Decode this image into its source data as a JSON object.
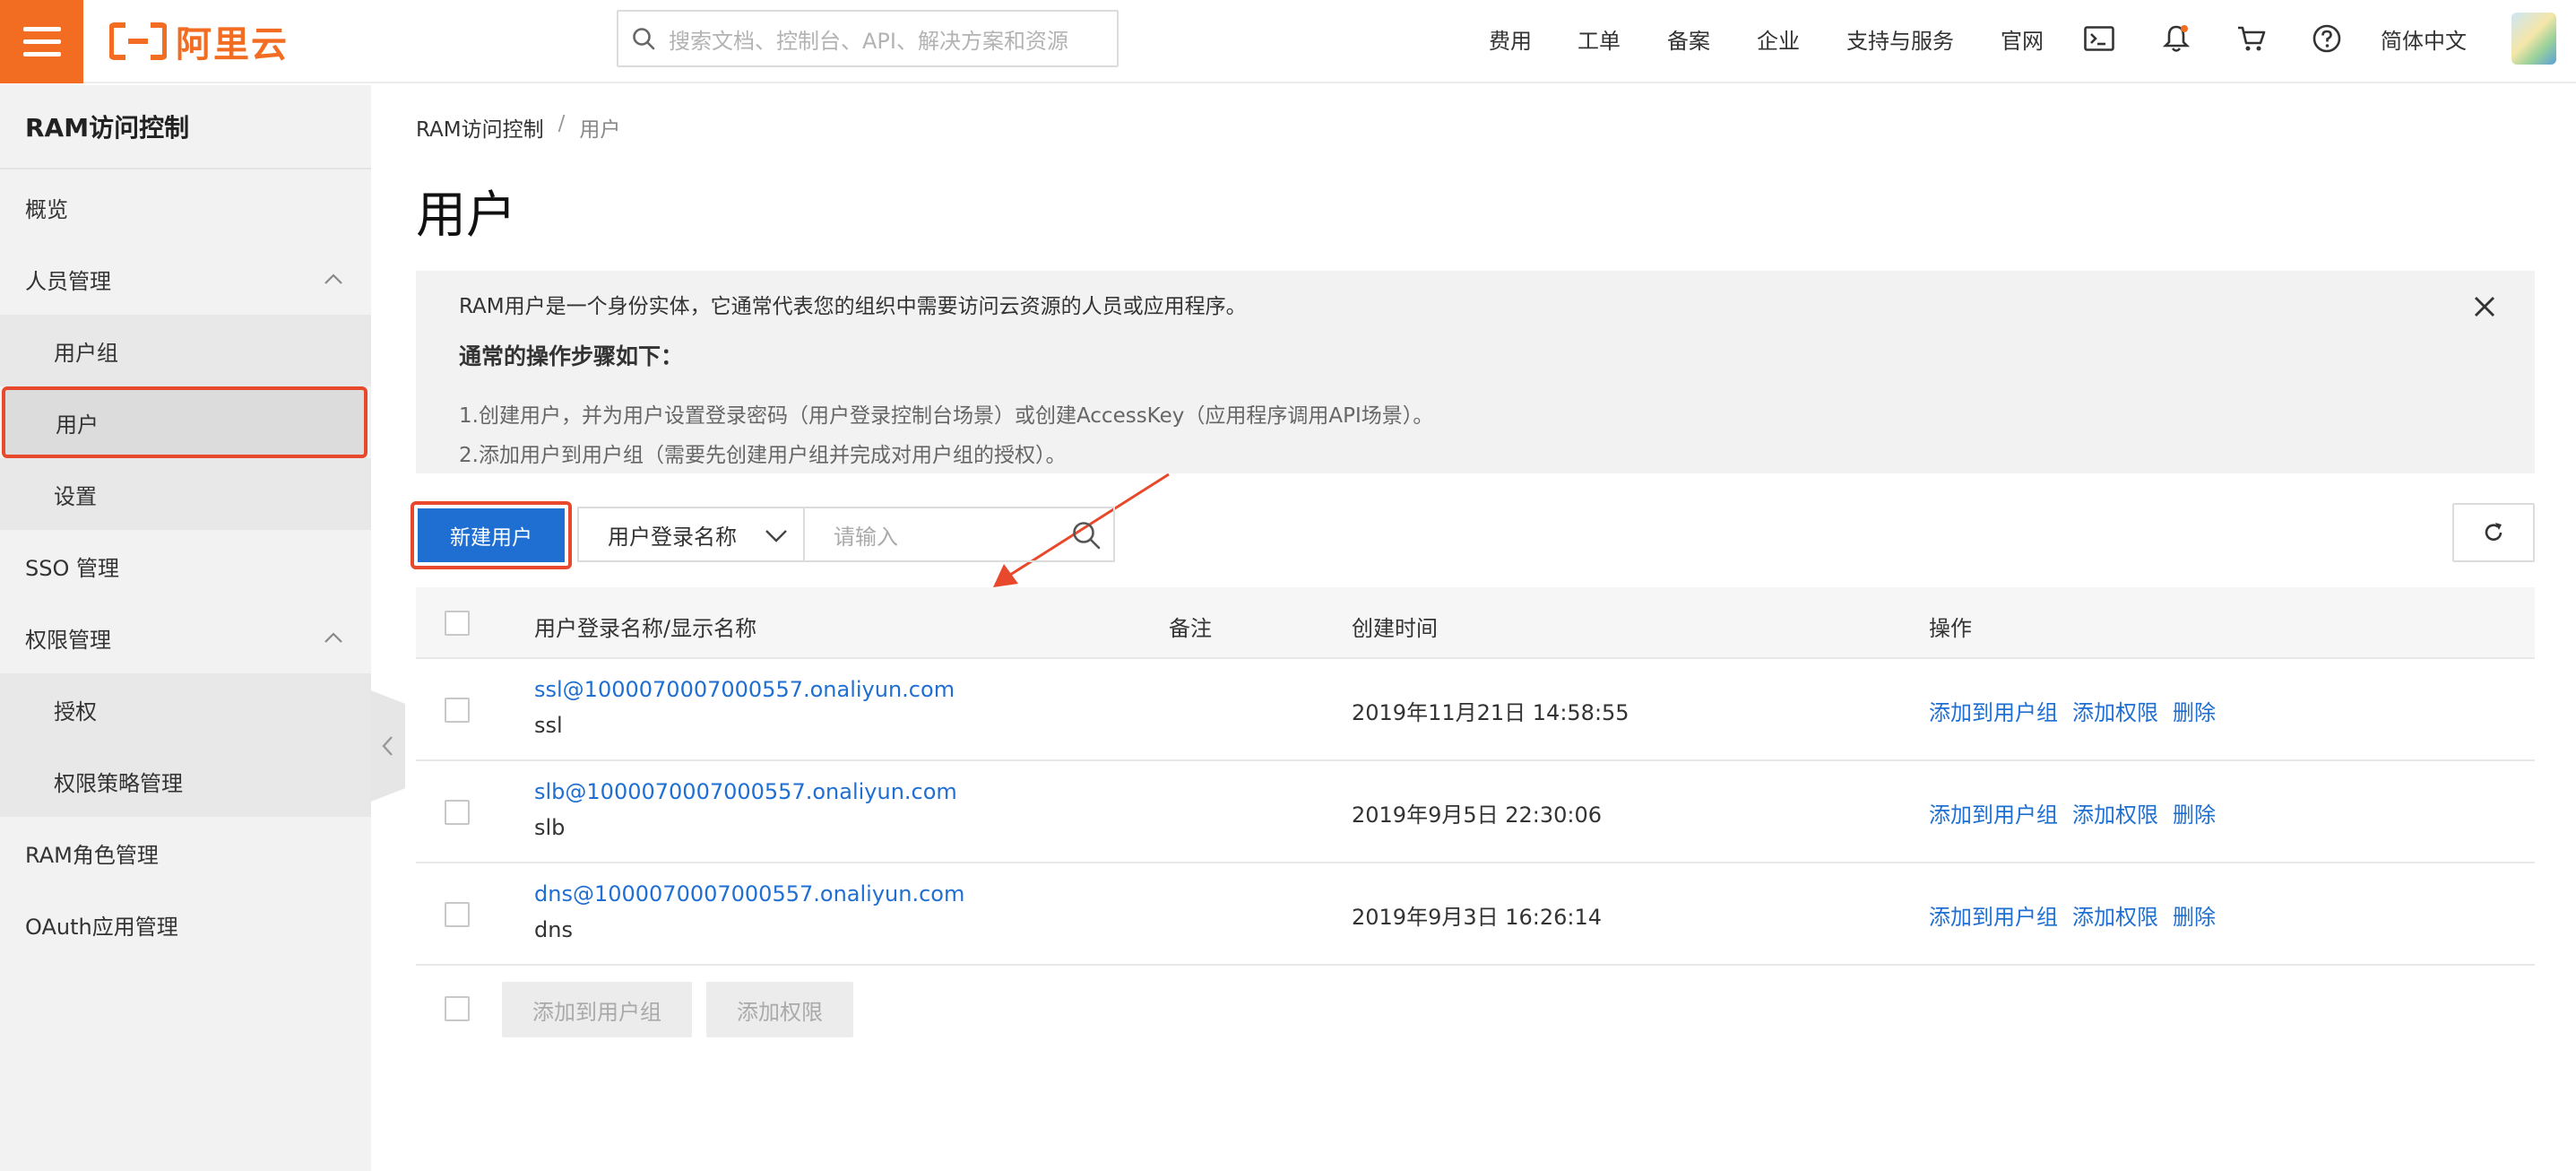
{
  "header": {
    "logo_text": "阿里云",
    "search_placeholder": "搜索文档、控制台、API、解决方案和资源",
    "nav_items": [
      "费用",
      "工单",
      "备案",
      "企业",
      "支持与服务",
      "官网"
    ],
    "language": "简体中文",
    "icons": [
      "terminal-icon",
      "bell-icon",
      "cart-icon",
      "help-icon"
    ],
    "brand_color": "#f26c21"
  },
  "sidebar": {
    "title": "RAM访问控制",
    "items": [
      {
        "label": "概览"
      },
      {
        "label": "人员管理"
      },
      {
        "label": "用户组"
      },
      {
        "label": "用户"
      },
      {
        "label": "设置"
      },
      {
        "label": "SSO 管理"
      },
      {
        "label": "权限管理"
      },
      {
        "label": "授权"
      },
      {
        "label": "权限策略管理"
      },
      {
        "label": "RAM角色管理"
      },
      {
        "label": "OAuth应用管理"
      }
    ]
  },
  "main": {
    "breadcrumb": {
      "root": "RAM访问控制",
      "separator": "/",
      "current": "用户"
    },
    "title": "用户",
    "info": {
      "description": "RAM用户是一个身份实体，它通常代表您的组织中需要访问云资源的人员或应用程序。",
      "heading": "通常的操作步骤如下：",
      "steps": [
        "1.创建用户，并为用户设置登录密码（用户登录控制台场景）或创建AccessKey（应用程序调用API场景）。",
        "2.添加用户到用户组（需要先创建用户组并完成对用户组的授权）。"
      ]
    },
    "toolbar": {
      "new_user": "新建用户",
      "filter_select": "用户登录名称",
      "search_placeholder": "请输入"
    },
    "table": {
      "columns": [
        "用户登录名称/显示名称",
        "备注",
        "创建时间",
        "操作"
      ],
      "rows": [
        {
          "login": "ssl@1000070007000557.onaliyun.com",
          "display": "ssl",
          "note": "",
          "created": "2019年11月21日 14:58:55"
        },
        {
          "login": "slb@1000070007000557.onaliyun.com",
          "display": "slb",
          "note": "",
          "created": "2019年9月5日 22:30:06"
        },
        {
          "login": "dns@1000070007000557.onaliyun.com",
          "display": "dns",
          "note": "",
          "created": "2019年9月3日 16:26:14"
        }
      ],
      "actions": [
        "添加到用户组",
        "添加权限",
        "删除"
      ],
      "footer_buttons": [
        "添加到用户组",
        "添加权限"
      ]
    },
    "accent_color": "#1f6fd3",
    "highlight_color": "#e8482b"
  }
}
